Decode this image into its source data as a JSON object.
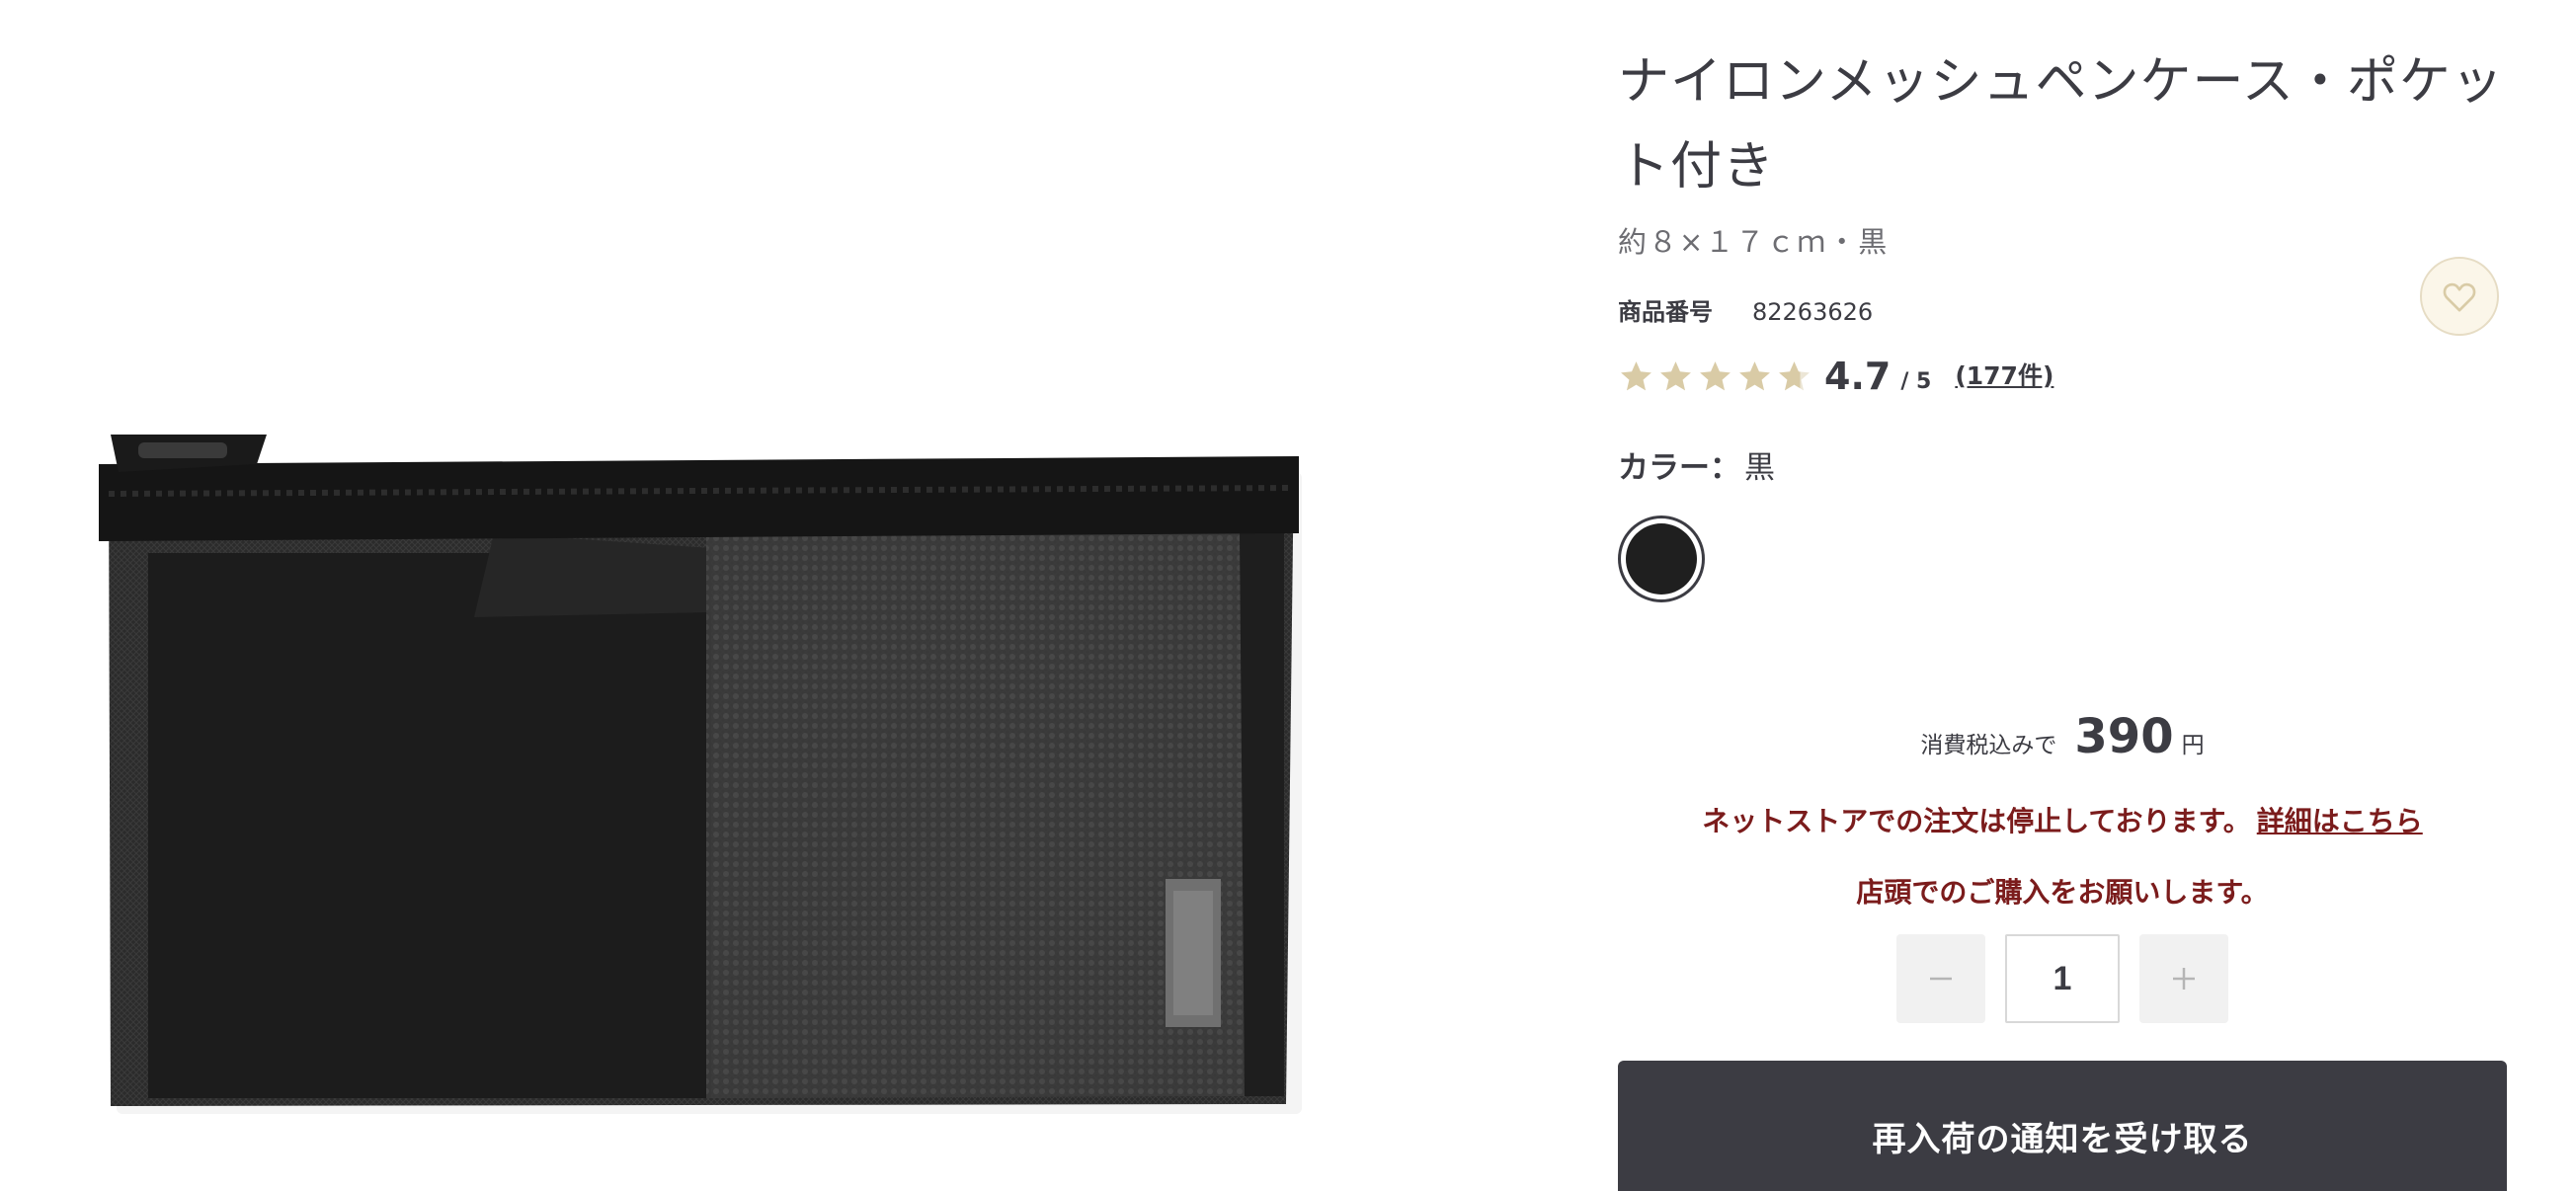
{
  "product": {
    "title": "ナイロンメッシュペンケース・ポケット付き",
    "subtitle": "約８×１７ｃｍ・黒",
    "image_alt": "nylon-mesh-pen-case-black"
  },
  "sku": {
    "label": "商品番号",
    "value": "82263626"
  },
  "rating": {
    "score": "4.7",
    "max_label": "/ 5",
    "review_count": "(177件)",
    "stars_value": 4.7,
    "star_color": "#d9cba6"
  },
  "color": {
    "label": "カラー：",
    "value": "黒",
    "swatch_hex": "#1f1f1f"
  },
  "price": {
    "prefix": "消費税込みで",
    "value": "390",
    "unit": "円"
  },
  "notice": {
    "line1": "ネットストアでの注文は停止しております。",
    "line1_link": "詳細はこちら",
    "line2": "店頭でのご購入をお願いします。",
    "color": "#7b1c1c"
  },
  "quantity": {
    "value": "1",
    "decrement_icon": "minus-icon",
    "increment_icon": "plus-icon"
  },
  "actions": {
    "restock_label": "再入荷の通知を受け取る",
    "favorite_icon": "heart-icon"
  }
}
